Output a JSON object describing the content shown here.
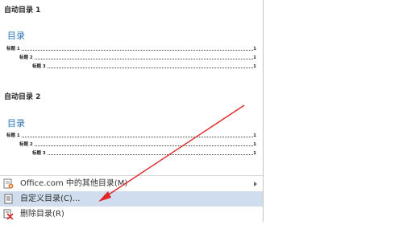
{
  "gallery": {
    "sections": [
      {
        "title": "自动目录 1",
        "heading": "目录",
        "entries": [
          {
            "label": "标题 1",
            "page": "1"
          },
          {
            "label": "标题 2",
            "page": "1"
          },
          {
            "label": "标题 3",
            "page": "1"
          }
        ]
      },
      {
        "title": "自动目录 2",
        "heading": "目录",
        "entries": [
          {
            "label": "标题 1",
            "page": "1"
          },
          {
            "label": "标题 2",
            "page": "1"
          },
          {
            "label": "标题 3",
            "page": "1"
          }
        ]
      }
    ]
  },
  "menu": {
    "items": [
      {
        "label": "Office.com 中的其他目录(M)",
        "icon": "office-web-icon",
        "has_submenu": true
      },
      {
        "label": "自定义目录(C)...",
        "icon": "document-icon",
        "highlighted": true
      },
      {
        "label": "删除目录(R)",
        "icon": "delete-icon"
      }
    ]
  },
  "colors": {
    "heading": "#2e75b6",
    "highlight": "#cfddee",
    "annotation_arrow": "#e0282a"
  }
}
